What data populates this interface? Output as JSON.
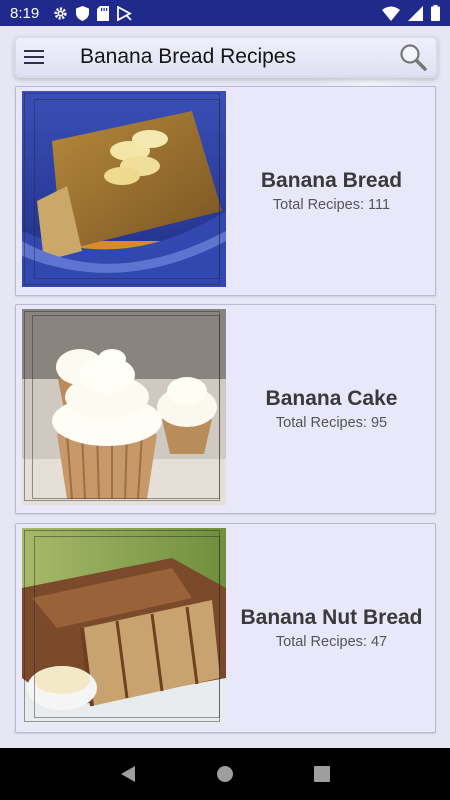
{
  "status_bar": {
    "time": "8:19",
    "left_icons": [
      "gear-icon",
      "shield-icon",
      "sd-card-icon",
      "play-protect-icon"
    ],
    "right_icons": [
      "wifi-icon",
      "signal-icon",
      "battery-icon"
    ]
  },
  "toolbar": {
    "title": "Banana Bread Recipes",
    "menu_icon": "hamburger-menu-icon",
    "search_icon": "search-icon"
  },
  "categories": [
    {
      "title": "Banana Bread",
      "count_text": "Total Recipes: 111",
      "image": "banana-bread-photo"
    },
    {
      "title": "Banana Cake",
      "count_text": "Total Recipes: 95",
      "image": "banana-cupcakes-photo"
    },
    {
      "title": "Banana Nut Bread",
      "count_text": "Total Recipes: 47",
      "image": "banana-nut-bread-photo"
    }
  ],
  "nav_bar": {
    "buttons": [
      "back-icon",
      "home-icon",
      "recents-icon"
    ]
  },
  "colors": {
    "status_bar": "#1f2a8c",
    "background": "#e6e6f5",
    "card": "#e8e8fa",
    "title_text": "#3a3a3a"
  }
}
